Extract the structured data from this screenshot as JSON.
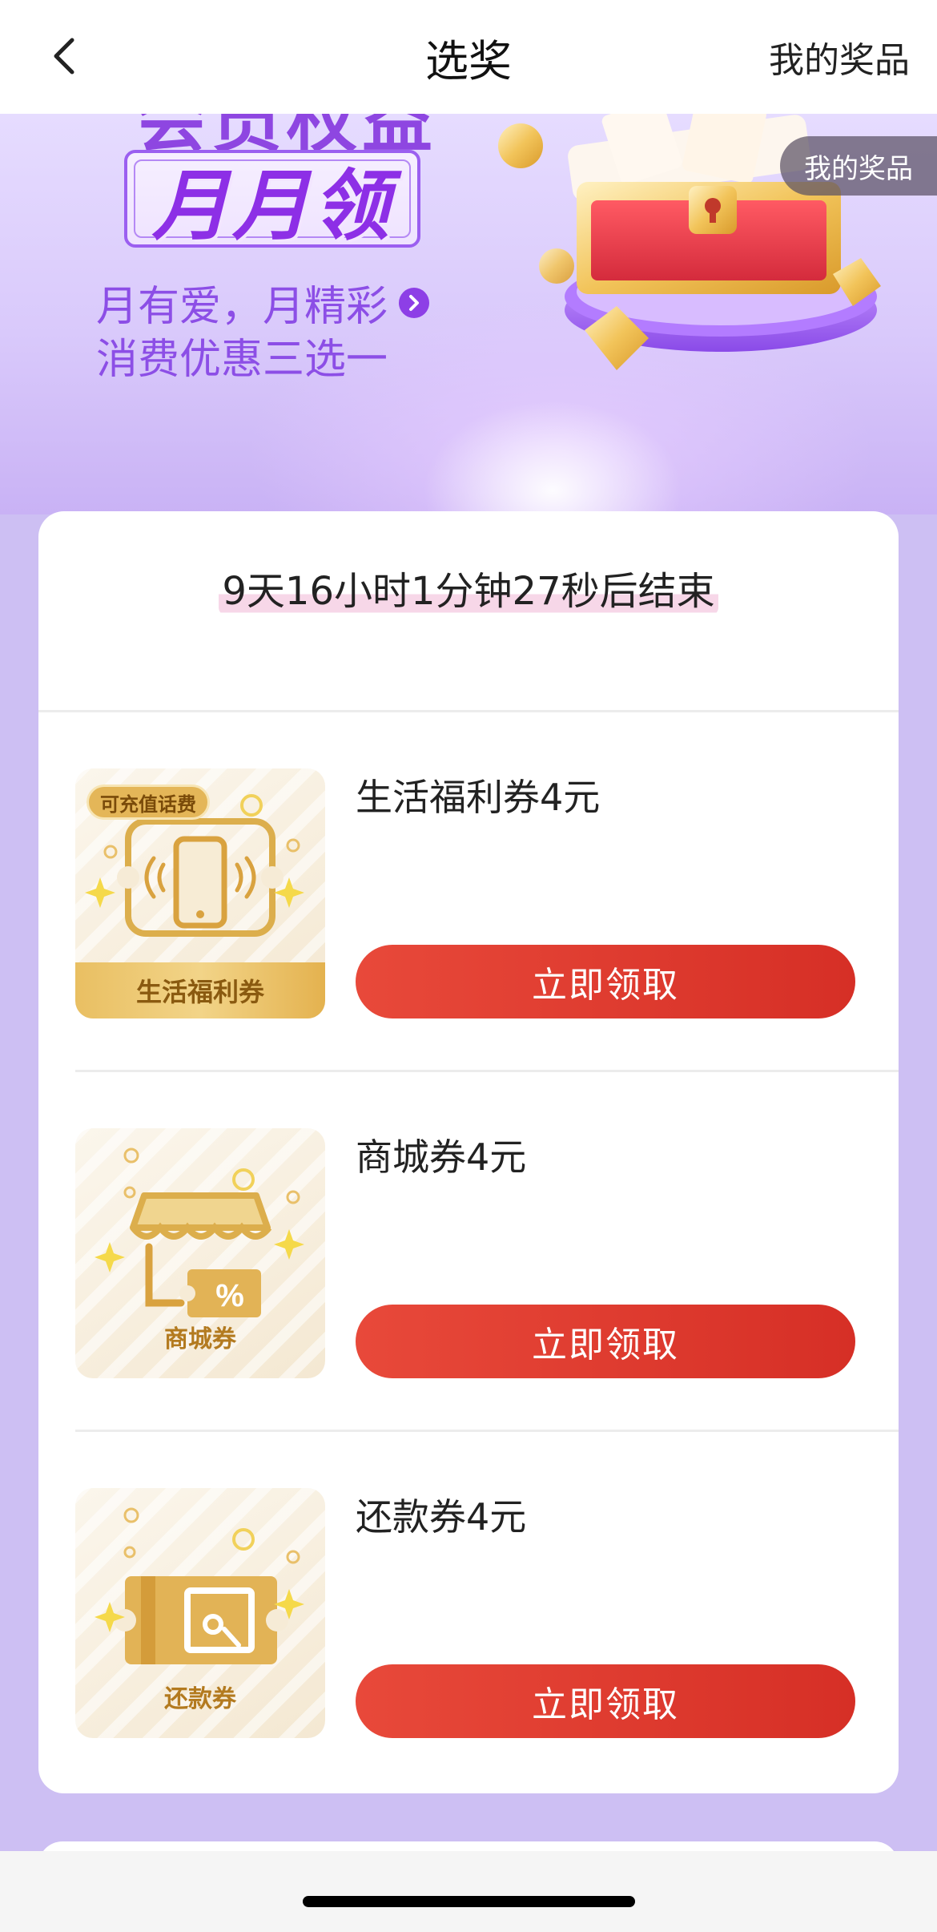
{
  "nav": {
    "title": "选奖",
    "right_link": "我的奖品",
    "back_icon": "chevron-left-icon"
  },
  "hero": {
    "cut_heading": "会员权益",
    "badge_text": "月月领",
    "line1": "月有爱，月精彩",
    "line2": "消费优惠三选一",
    "arrow_icon": "chevron-right-circle-icon",
    "image": "treasure-chest-illustration"
  },
  "floating_tag": "我的奖品",
  "countdown": "9天16小时1分钟27秒后结束",
  "prizes": [
    {
      "name": "生活福利券4元",
      "thumb_label": "生活福利券",
      "thumb_tag": "可充值话费",
      "icon": "phone-ticket-icon",
      "button": "立即领取"
    },
    {
      "name": "商城券4元",
      "thumb_label": "商城券",
      "icon": "store-coupon-icon",
      "button": "立即领取"
    },
    {
      "name": "还款券4元",
      "thumb_label": "还款券",
      "icon": "repayment-ticket-icon",
      "button": "立即领取"
    }
  ],
  "colors": {
    "page_bg": "#cdbff3",
    "accent_purple": "#8d3fe6",
    "button_red": "#e03c2f",
    "gold": "#e4b658"
  }
}
